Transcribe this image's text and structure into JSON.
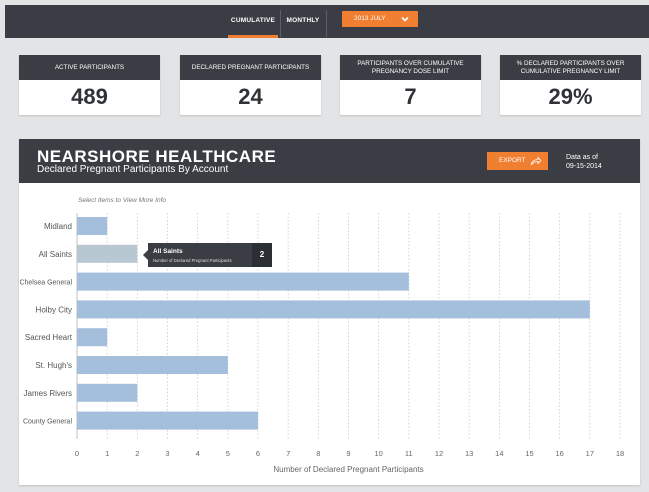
{
  "topbar": {
    "tabs": [
      {
        "label": "CUMULATIVE",
        "active": true
      },
      {
        "label": "MONTHLY",
        "active": false
      }
    ],
    "period_select": {
      "value": "2013 JULY",
      "icon": "chevron-down-icon"
    }
  },
  "stats": [
    {
      "label": "ACTIVE PARTICIPANTS",
      "value": "489"
    },
    {
      "label": "DECLARED PREGNANT PARTICIPANTS",
      "value": "24"
    },
    {
      "label": "PARTICIPANTS OVER CUMULATIVE PREGNANCY DOSE LIMIT",
      "value": "7"
    },
    {
      "label": "% DECLARED PARTICIPANTS OVER CUMULATIVE PREGNANCY LIMIT",
      "value": "29%"
    }
  ],
  "panel": {
    "title": "NEARSHORE HEALTHCARE",
    "subtitle": "Declared Pregnant Participants By Account",
    "export_label": "EXPORT",
    "export_icon": "share-arrow-icon",
    "asof_label": "Data as of",
    "asof_date": "09-15-2014",
    "hint": "Select Items to View More Info"
  },
  "tooltip": {
    "name": "All Saints",
    "label": "Number of Declared Pregnant Participants",
    "value": "2"
  },
  "colors": {
    "bar": "#a3bfdc",
    "bar_selected": "#b7c8d3",
    "accent": "#f07f32",
    "dark": "#3a3e44"
  },
  "chart_data": {
    "type": "bar",
    "orientation": "horizontal",
    "categories": [
      "Midland",
      "All Saints",
      "Chelsea General",
      "Holby City",
      "Sacred Heart",
      "St. Hugh's",
      "James Rivers",
      "County General"
    ],
    "values": [
      1,
      2,
      11,
      17,
      1,
      5,
      2,
      6
    ],
    "selected": "All Saints",
    "xlabel": "Number of Declared Pregnant Participants",
    "xlim": [
      0,
      18
    ],
    "xticks": [
      "0",
      "1",
      "2",
      "3",
      "4",
      "5",
      "6",
      "7",
      "8",
      "9",
      "10",
      "11",
      "12",
      "13",
      "14",
      "15",
      "16",
      "17",
      "18"
    ],
    "grid": "vertical-dotted"
  }
}
